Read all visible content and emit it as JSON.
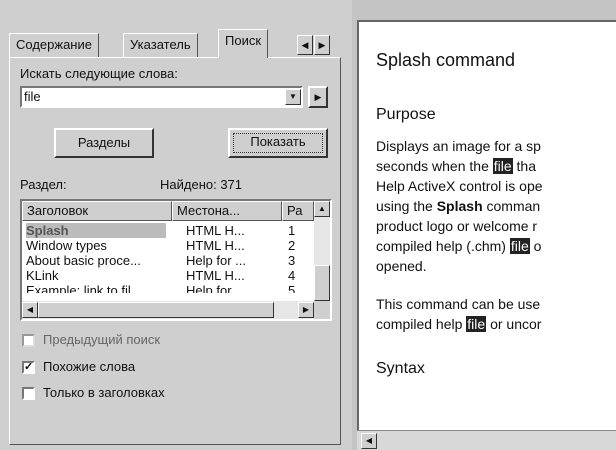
{
  "tabs": [
    {
      "label": "Содержание",
      "active": false
    },
    {
      "label": "Указатель",
      "active": false
    },
    {
      "label": "Поиск",
      "active": true
    }
  ],
  "search": {
    "prompt_label": "Искать следующие слова:",
    "query_value": "file",
    "topics_button": "Разделы",
    "show_button": "Показать",
    "section_label": "Раздел:",
    "found_label": "Найдено: 371"
  },
  "results": {
    "columns": [
      "Заголовок",
      "Местона...",
      "Ра"
    ],
    "rows": [
      {
        "title": "Splash",
        "location": "HTML H...",
        "rank": "1",
        "selected": true
      },
      {
        "title": "Window types",
        "location": "HTML H...",
        "rank": "2",
        "selected": false
      },
      {
        "title": "About basic proce...",
        "location": "Help for ...",
        "rank": "3",
        "selected": false
      },
      {
        "title": "KLink",
        "location": "HTML H...",
        "rank": "4",
        "selected": false
      },
      {
        "title": "Example: link to fil...",
        "location": "Help for ...",
        "rank": "5",
        "selected": false
      }
    ]
  },
  "options": [
    {
      "label": "Предыдущий поиск",
      "checked": false,
      "disabled": true
    },
    {
      "label": "Похожие слова",
      "checked": true,
      "disabled": false
    },
    {
      "label": "Только в заголовках",
      "checked": false,
      "disabled": false
    }
  ],
  "topic": {
    "title": "Splash command",
    "purpose_heading": "Purpose",
    "purpose_lines": [
      [
        "Displays an image for a sp"
      ],
      [
        "seconds when the ",
        "file",
        " tha"
      ],
      [
        "Help ActiveX control is ope"
      ],
      [
        "using the ",
        "Splash",
        " comman"
      ],
      [
        "product logo or welcome r"
      ],
      [
        "compiled help (.chm) ",
        "file",
        " o"
      ],
      [
        "opened."
      ]
    ],
    "usage_lines": [
      [
        "This command can be use"
      ],
      [
        "compiled help ",
        "file",
        " or uncor"
      ]
    ],
    "syntax_heading": "Syntax"
  },
  "colors": {
    "highlight_bg": "#222222",
    "window_bg": "#ffffff",
    "chrome_bg": "#cfcfcf"
  }
}
